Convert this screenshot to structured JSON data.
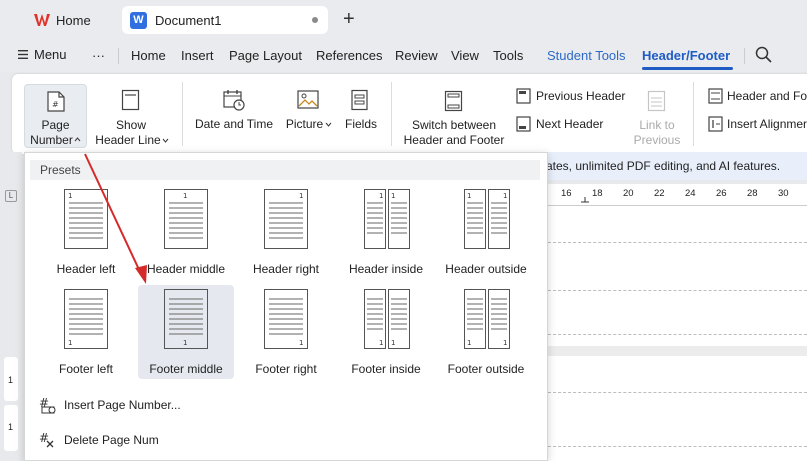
{
  "tabs": {
    "home_label": "Home",
    "doc_label": "Document1",
    "doc_icon": "W",
    "new_tab": "+"
  },
  "menubar": {
    "menu_label": "Menu",
    "more": "···",
    "items": [
      "Home",
      "Insert",
      "Page Layout",
      "References",
      "Review",
      "View",
      "Tools"
    ],
    "student_tools": "Student Tools",
    "active_tab": "Header/Footer"
  },
  "ribbon": {
    "page_number": [
      "Page",
      "Number"
    ],
    "show_header_line": [
      "Show",
      "Header Line"
    ],
    "date_and_time": "Date and Time",
    "picture": "Picture",
    "fields": "Fields",
    "switch_between": [
      "Switch between",
      "Header and Footer"
    ],
    "previous_header": "Previous Header",
    "next_header": "Next Header",
    "link_to_previous": [
      "Link to",
      "Previous"
    ],
    "header_and_footer": "Header and Fo",
    "insert_alignment": "Insert Alignmer"
  },
  "infobar": {
    "text": "ates, unlimited PDF editing, and AI features."
  },
  "ruler": {
    "numbers": [
      "16",
      "18",
      "20",
      "22",
      "24",
      "26",
      "28",
      "30"
    ]
  },
  "dropdown": {
    "presets_title": "Presets",
    "presets_row1": [
      "Header left",
      "Header middle",
      "Header right",
      "Header inside",
      "Header outside"
    ],
    "presets_row2": [
      "Footer left",
      "Footer middle",
      "Footer right",
      "Footer inside",
      "Footer outside"
    ],
    "insert_page_number": "Insert Page Number...",
    "delete_page_num": "Delete Page Num"
  },
  "left_rail": {
    "marker": "1"
  },
  "colors": {
    "accent": "#1f5cc4",
    "student": "#2d6ac8",
    "arrow": "#d42a2a",
    "selected": "#e5e9ef"
  }
}
